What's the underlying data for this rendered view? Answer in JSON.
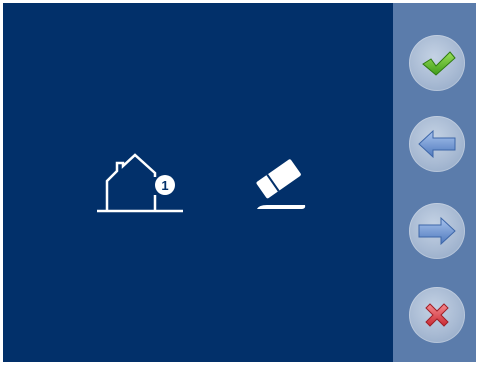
{
  "screen": {
    "background": "#02306a",
    "side_panel_color": "#5b7cab"
  },
  "main": {
    "home_icon": {
      "icon": "home-icon",
      "badge_number": "1"
    },
    "eraser_icon": {
      "icon": "eraser-icon"
    }
  },
  "side_buttons": [
    {
      "name": "confirm-button",
      "icon": "checkmark-icon",
      "color": "#5ab82a"
    },
    {
      "name": "back-button",
      "icon": "arrow-left-icon",
      "color": "#6f95d0"
    },
    {
      "name": "next-button",
      "icon": "arrow-right-icon",
      "color": "#6f95d0"
    },
    {
      "name": "cancel-button",
      "icon": "close-icon",
      "color": "#e0474e"
    }
  ]
}
